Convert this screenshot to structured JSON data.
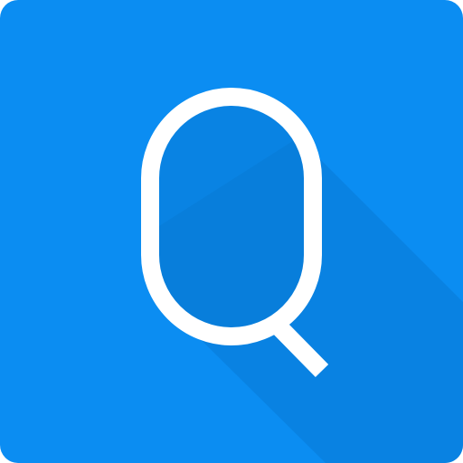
{
  "app_icon": {
    "name": "q-app-icon",
    "letter": "Q",
    "colors": {
      "background": "#0b8df2",
      "shadow": "#0a7fdc",
      "inner_shadow": "#0879d4",
      "glyph": "#ffffff"
    }
  }
}
